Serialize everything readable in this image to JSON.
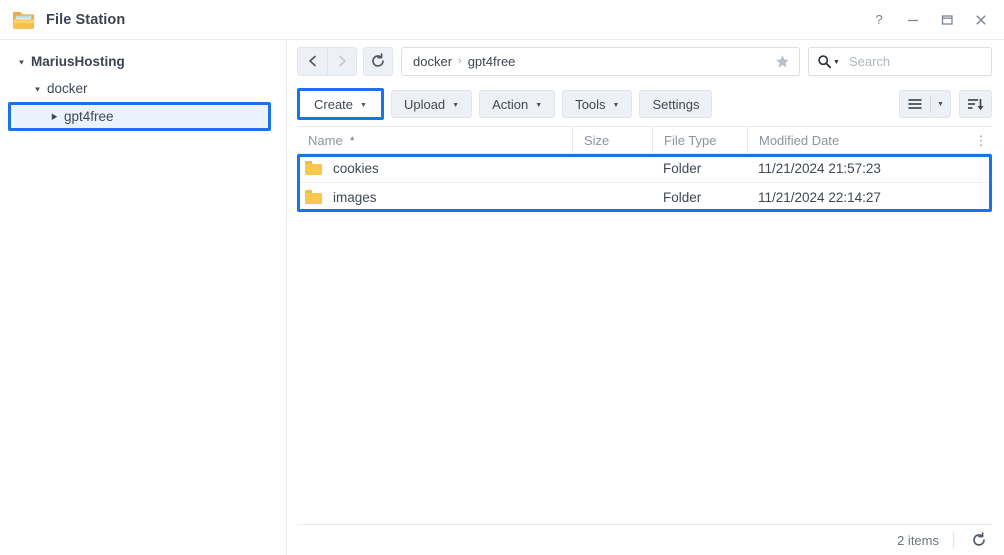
{
  "window": {
    "title": "File Station",
    "icon": "folder-icon",
    "controls": [
      {
        "name": "help-button",
        "glyph": "?"
      },
      {
        "name": "minimize-button",
        "glyph": "—"
      },
      {
        "name": "maximize-button",
        "glyph": "☐"
      },
      {
        "name": "close-button",
        "glyph": "✕"
      }
    ]
  },
  "sidebar": {
    "items": [
      {
        "label": "MariusHosting",
        "level": 0,
        "expanded": true,
        "selected": false
      },
      {
        "label": "docker",
        "level": 1,
        "expanded": true,
        "selected": false
      },
      {
        "label": "gpt4free",
        "level": 2,
        "expanded": false,
        "selected": true
      }
    ]
  },
  "nav": {
    "back_label": "Back",
    "forward_label": "Forward",
    "refresh_label": "Refresh",
    "breadcrumb": [
      "docker",
      "gpt4free"
    ],
    "breadcrumb_separator": "›",
    "favorite_label": "Add to favorites"
  },
  "search": {
    "placeholder": "Search",
    "value": ""
  },
  "toolbar": {
    "create_label": "Create",
    "upload_label": "Upload",
    "action_label": "Action",
    "tools_label": "Tools",
    "settings_label": "Settings",
    "view_mode_label": "List view",
    "sort_label": "Sort order",
    "dropdown_caret": "▾"
  },
  "table": {
    "columns": [
      {
        "label": "Name",
        "sorted": true,
        "sort_arrow": "▲"
      },
      {
        "label": "Size",
        "sorted": false,
        "sort_arrow": ""
      },
      {
        "label": "File Type",
        "sorted": false,
        "sort_arrow": ""
      },
      {
        "label": "Modified Date",
        "sorted": false,
        "sort_arrow": ""
      }
    ],
    "options_label": "⋮",
    "rows": [
      {
        "name": "cookies",
        "size": "",
        "file_type": "Folder",
        "modified": "11/21/2024 21:57:23",
        "icon": "folder-icon"
      },
      {
        "name": "images",
        "size": "",
        "file_type": "Folder",
        "modified": "11/21/2024 22:14:27",
        "icon": "folder-icon"
      }
    ]
  },
  "status": {
    "items_count": "2 items",
    "refresh_label": "Refresh"
  },
  "colors": {
    "accent": "#1a73e8",
    "folder": "#fac64e",
    "text": "#3f4854",
    "muted": "#8c949e"
  }
}
